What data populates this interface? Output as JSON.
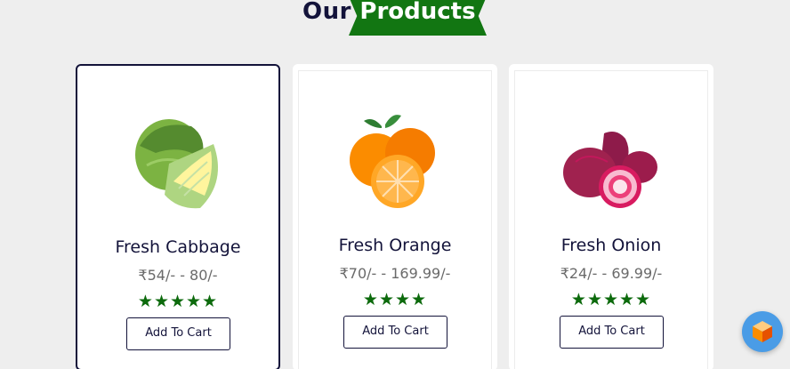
{
  "heading": {
    "prefix": "Our",
    "highlight": "Products",
    "ribbon_color": "#127612"
  },
  "products": [
    {
      "name": "Fresh Cabbage",
      "price": "₹54/- - 80/-",
      "rating_stars": "★★★★★",
      "rating": 5,
      "button": "Add To Cart",
      "image": "cabbage-image"
    },
    {
      "name": "Fresh Orange",
      "price": "₹70/- - 169.99/-",
      "rating_stars": "★★★★",
      "rating": 4,
      "button": "Add To Cart",
      "image": "orange-image"
    },
    {
      "name": "Fresh Onion",
      "price": "₹24/- - 69.99/-",
      "rating_stars": "★★★★★",
      "rating": 5,
      "button": "Add To Cart",
      "image": "onion-image"
    }
  ],
  "colors": {
    "accent_green": "#127612",
    "star_green": "#0c6a0c",
    "navy": "#13133a",
    "chat_widget": "#4a9ce6"
  },
  "widget": {
    "icon": "chat-cube-icon"
  }
}
